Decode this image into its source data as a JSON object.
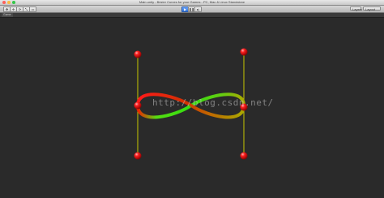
{
  "window": {
    "title": "Main.unity - Bézier Curves for your Games - PC, Mac & Linux Standalone",
    "light_colors": [
      "#fc605b",
      "#fdbc40",
      "#34c84a"
    ]
  },
  "toolbar": {
    "tools": [
      "✥",
      "✛",
      "⟳",
      "⤡",
      "▭"
    ],
    "play_icon": "▶",
    "pause_icon": "❚❚",
    "step_icon": "▸|",
    "layers_label": "Layers",
    "layout_label": "Layout"
  },
  "panel": {
    "tab_label": "Game"
  },
  "scene": {
    "curve_colors": [
      "#ff1a1a",
      "#33dd11",
      "#cc5500",
      "#aaaa00"
    ],
    "control_point_color": "#e00000",
    "handle_line_color": "#c8c800"
  },
  "watermark": "http://blog.csdn.net/"
}
